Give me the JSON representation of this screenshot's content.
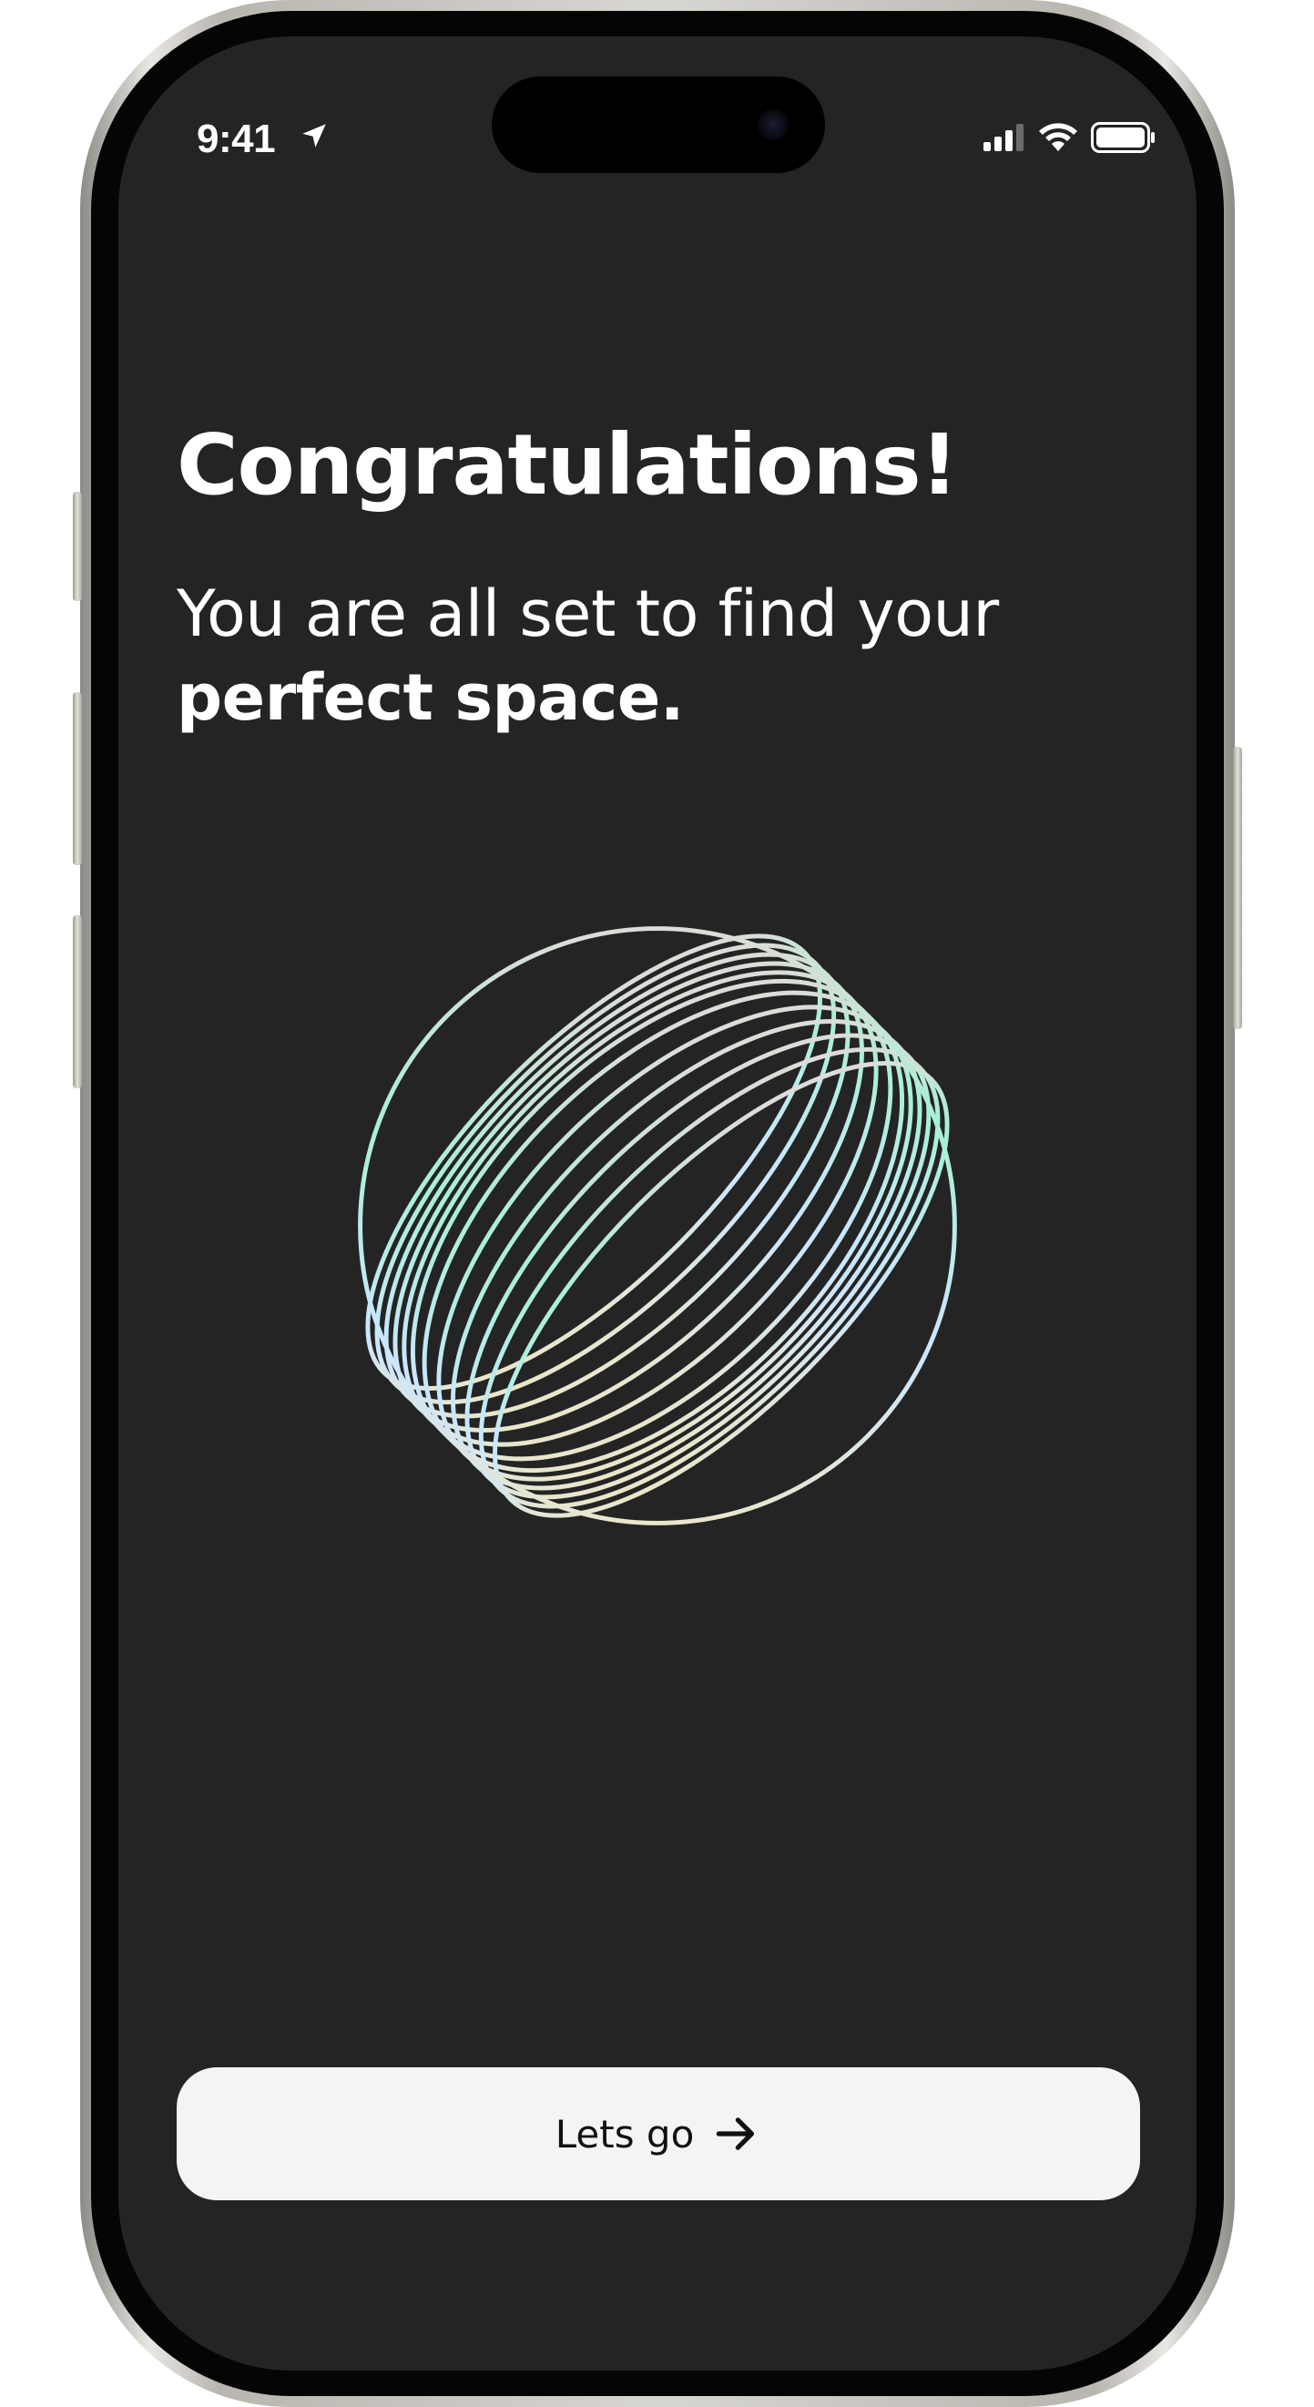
{
  "status_bar": {
    "time": "9:41",
    "icons": [
      "location-arrow-icon",
      "cellular-signal-icon",
      "wifi-icon",
      "battery-icon"
    ]
  },
  "content": {
    "title": "Congratulations!",
    "subtitle_regular": "You are all set to find your",
    "subtitle_bold": "perfect space.",
    "illustration": "sphere-graphic"
  },
  "cta": {
    "label": "Lets go",
    "icon": "arrow-right-icon"
  },
  "colors": {
    "background": "#242424",
    "text": "#ffffff",
    "button_bg": "#f4f4f4",
    "button_text": "#111111",
    "gradient": [
      "#ffe6a6",
      "#cbe6ff",
      "#a8f0d6",
      "#ffcfd9"
    ]
  }
}
